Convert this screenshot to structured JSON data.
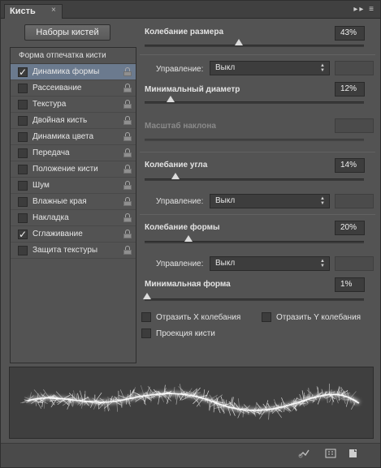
{
  "window": {
    "tab_title": "Кисть",
    "close_glyph": "×",
    "menu_glyph": "▸▸ ≡"
  },
  "presets_button": "Наборы кистей",
  "list": {
    "header": "Форма отпечатка кисти",
    "items": [
      {
        "label": "Динамика формы",
        "checked": true,
        "selected": true
      },
      {
        "label": "Рассеивание",
        "checked": false
      },
      {
        "label": "Текстура",
        "checked": false
      },
      {
        "label": "Двойная кисть",
        "checked": false
      },
      {
        "label": "Динамика цвета",
        "checked": false
      },
      {
        "label": "Передача",
        "checked": false
      },
      {
        "label": "Положение кисти",
        "checked": false
      },
      {
        "label": "Шум",
        "checked": false
      },
      {
        "label": "Влажные края",
        "checked": false
      },
      {
        "label": "Накладка",
        "checked": false
      },
      {
        "label": "Сглаживание",
        "checked": true
      },
      {
        "label": "Защита текстуры",
        "checked": false
      }
    ],
    "check_glyph": "✓"
  },
  "settings": {
    "size_jitter": {
      "label": "Колебание размера",
      "value": "43%",
      "level": 0.43
    },
    "size_control": {
      "label": "Управление:",
      "value": "Выкл"
    },
    "min_diameter": {
      "label": "Минимальный диаметр",
      "value": "12%",
      "level": 0.12
    },
    "tilt_scale": {
      "label": "Масштаб наклона"
    },
    "angle_jitter": {
      "label": "Колебание угла",
      "value": "14%",
      "level": 0.14
    },
    "angle_control": {
      "label": "Управление:",
      "value": "Выкл"
    },
    "roundness_jitter": {
      "label": "Колебание формы",
      "value": "20%",
      "level": 0.2
    },
    "roundness_control": {
      "label": "Управление:",
      "value": "Выкл"
    },
    "min_roundness": {
      "label": "Минимальная форма",
      "value": "1%",
      "level": 0.01
    },
    "flip_x": {
      "label": "Отразить X колебания",
      "checked": false
    },
    "flip_y": {
      "label": "Отразить Y колебания",
      "checked": false
    },
    "brush_projection": {
      "label": "Проекция кисти",
      "checked": false
    }
  },
  "colors": {
    "panel": "#535353",
    "selected_row": "#6b7a8e",
    "field": "#3d3d3d"
  }
}
